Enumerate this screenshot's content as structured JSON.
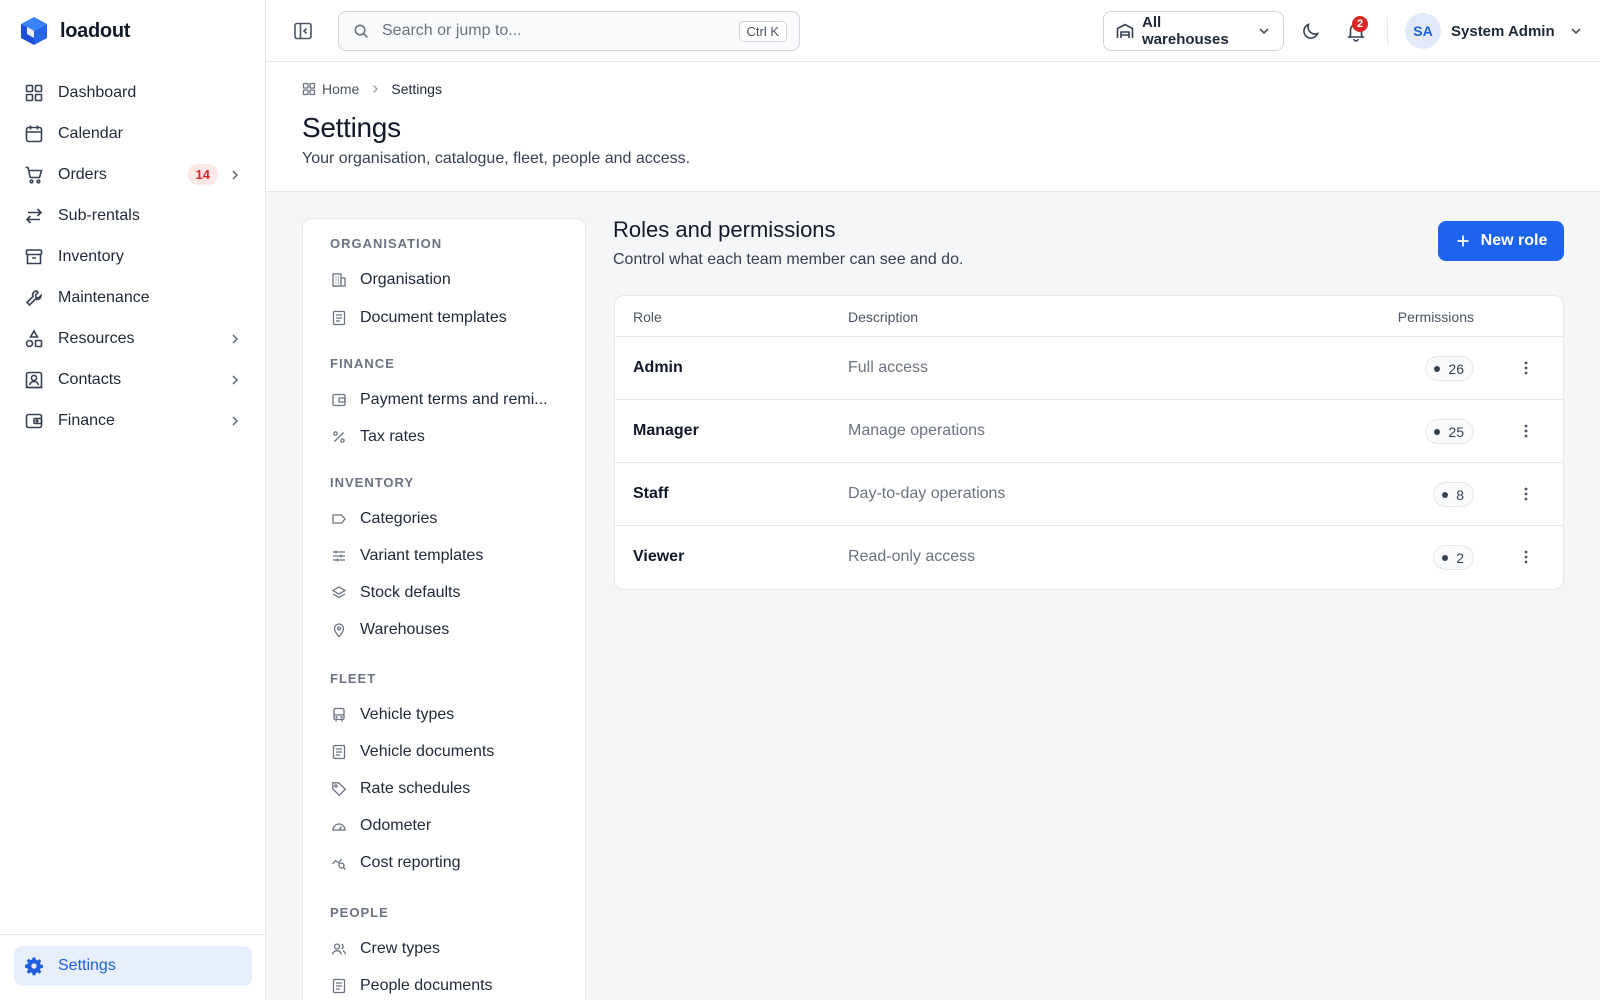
{
  "brand": {
    "name": "loadout",
    "color": "#1d63ed"
  },
  "sidebar": {
    "items": [
      {
        "label": "Dashboard",
        "icon": "grid-icon"
      },
      {
        "label": "Calendar",
        "icon": "calendar-icon"
      },
      {
        "label": "Orders",
        "icon": "cart-icon",
        "badge": "14",
        "expandable": true
      },
      {
        "label": "Sub-rentals",
        "icon": "swap-arrows-icon"
      },
      {
        "label": "Inventory",
        "icon": "archive-icon"
      },
      {
        "label": "Maintenance",
        "icon": "wrench-icon"
      },
      {
        "label": "Resources",
        "icon": "shapes-icon",
        "expandable": true
      },
      {
        "label": "Contacts",
        "icon": "contact-card-icon",
        "expandable": true
      },
      {
        "label": "Finance",
        "icon": "wallet-icon",
        "expandable": true
      }
    ],
    "settings_label": "Settings"
  },
  "topbar": {
    "search_placeholder": "Search or jump to...",
    "search_shortcut": "Ctrl K",
    "warehouse_label": "All warehouses",
    "notification_count": "2",
    "user_initials": "SA",
    "user_name": "System Admin"
  },
  "page": {
    "breadcrumb": [
      "Home",
      "Settings"
    ],
    "title": "Settings",
    "subtitle": "Your organisation, catalogue, fleet, people and access."
  },
  "settings_nav": {
    "groups": [
      {
        "title": "ORGANISATION",
        "items": [
          {
            "label": "Organisation",
            "icon": "building-icon"
          },
          {
            "label": "Document templates",
            "icon": "document-icon"
          }
        ]
      },
      {
        "title": "FINANCE",
        "items": [
          {
            "label": "Payment terms and remi...",
            "icon": "wallet-icon"
          },
          {
            "label": "Tax rates",
            "icon": "percent-icon"
          }
        ]
      },
      {
        "title": "INVENTORY",
        "items": [
          {
            "label": "Categories",
            "icon": "label-icon"
          },
          {
            "label": "Variant templates",
            "icon": "sliders-icon"
          },
          {
            "label": "Stock defaults",
            "icon": "layers-icon"
          },
          {
            "label": "Warehouses",
            "icon": "map-pin-icon"
          }
        ]
      },
      {
        "title": "FLEET",
        "items": [
          {
            "label": "Vehicle types",
            "icon": "bus-icon"
          },
          {
            "label": "Vehicle documents",
            "icon": "document-icon"
          },
          {
            "label": "Rate schedules",
            "icon": "tag-icon"
          },
          {
            "label": "Odometer",
            "icon": "gauge-icon"
          },
          {
            "label": "Cost reporting",
            "icon": "chart-search-icon"
          }
        ]
      },
      {
        "title": "PEOPLE",
        "items": [
          {
            "label": "Crew types",
            "icon": "users-icon"
          },
          {
            "label": "People documents",
            "icon": "document-icon"
          }
        ]
      }
    ]
  },
  "roles": {
    "title": "Roles and permissions",
    "subtitle": "Control what each team member can see and do.",
    "new_button": "New role",
    "columns": {
      "role": "Role",
      "description": "Description",
      "permissions": "Permissions"
    },
    "rows": [
      {
        "role": "Admin",
        "description": "Full access",
        "permissions": "26"
      },
      {
        "role": "Manager",
        "description": "Manage operations",
        "permissions": "25"
      },
      {
        "role": "Staff",
        "description": "Day-to-day operations",
        "permissions": "8"
      },
      {
        "role": "Viewer",
        "description": "Read-only access",
        "permissions": "2"
      }
    ]
  }
}
